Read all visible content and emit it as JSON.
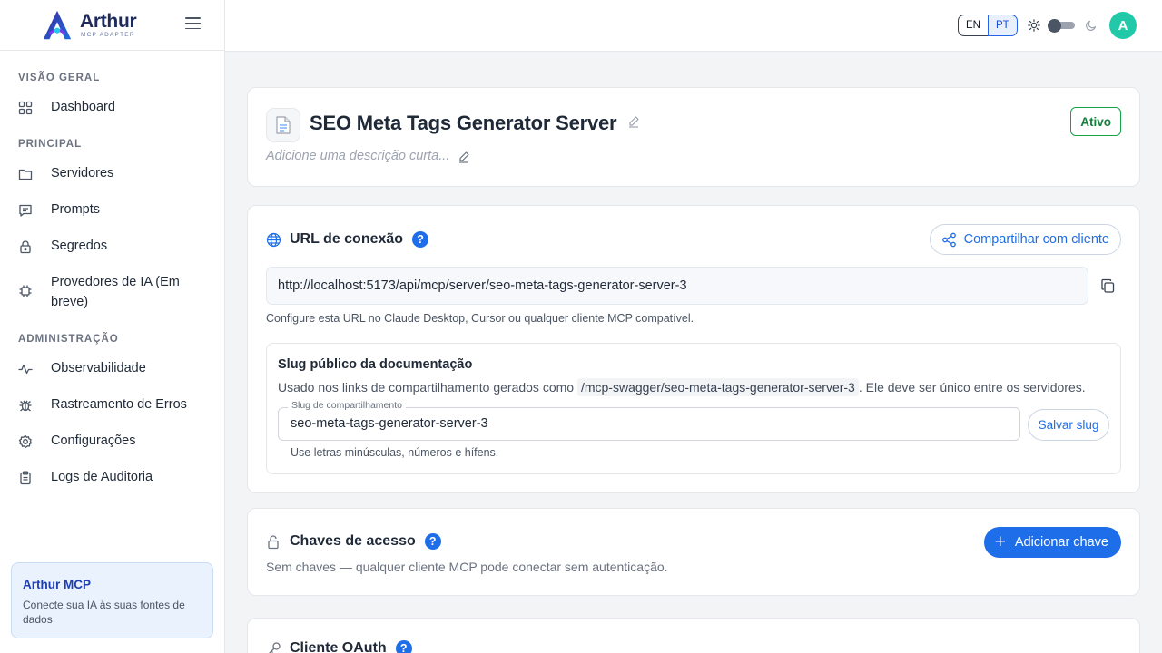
{
  "brand": {
    "name": "Arthur",
    "subtitle": "MCP ADAPTER"
  },
  "sidebar": {
    "sections": [
      {
        "label": "VISÃO GERAL"
      },
      {
        "label": "PRINCIPAL"
      },
      {
        "label": "ADMINISTRAÇÃO"
      }
    ],
    "items": [
      {
        "label": "Dashboard",
        "icon": "grid-icon"
      },
      {
        "label": "Servidores",
        "icon": "folder-icon"
      },
      {
        "label": "Prompts",
        "icon": "message-icon"
      },
      {
        "label": "Segredos",
        "icon": "lock-icon"
      },
      {
        "label": "Provedores de IA (Em breve)",
        "icon": "chip-icon"
      },
      {
        "label": "Observabilidade",
        "icon": "activity-icon"
      },
      {
        "label": "Rastreamento de Erros",
        "icon": "bug-icon"
      },
      {
        "label": "Configurações",
        "icon": "gear-icon"
      },
      {
        "label": "Logs de Auditoria",
        "icon": "clipboard-icon"
      }
    ],
    "promo": {
      "title": "Arthur MCP",
      "description": "Conecte sua IA às suas fontes de dados"
    }
  },
  "topbar": {
    "languages": [
      "EN",
      "PT"
    ],
    "active_language": "PT",
    "avatar_initial": "A",
    "avatar_color": "#22c9a8"
  },
  "server": {
    "name": "SEO Meta Tags Generator Server",
    "description_placeholder": "Adicione uma descrição curta...",
    "status": "Ativo"
  },
  "connection": {
    "title": "URL de conexão",
    "help": "?",
    "share_label": "Compartilhar com cliente",
    "url": "http://localhost:5173/api/mcp/server/seo-meta-tags-generator-server-3",
    "help_text": "Configure esta URL no Claude Desktop, Cursor ou qualquer cliente MCP compatível.",
    "slug": {
      "title": "Slug público da documentação",
      "desc_before": "Usado nos links de compartilhamento gerados como",
      "desc_path": "/mcp-swagger/seo-meta-tags-generator-server-3",
      "desc_after": ". Ele deve ser único entre os servidores.",
      "field_label": "Slug de compartilhamento",
      "field_value": "seo-meta-tags-generator-server-3",
      "save_label": "Salvar slug",
      "hint": "Use letras minúsculas, números e hífens."
    }
  },
  "access_keys": {
    "title": "Chaves de acesso",
    "help": "?",
    "add_label": "Adicionar chave",
    "empty_text": "Sem chaves — qualquer cliente MCP pode conectar sem autenticação."
  },
  "oauth": {
    "title": "Cliente OAuth",
    "help": "?"
  },
  "colors": {
    "accent": "#1d6ee8",
    "status_active": "#16a34a",
    "promo_bg": "#eaf2fd"
  }
}
